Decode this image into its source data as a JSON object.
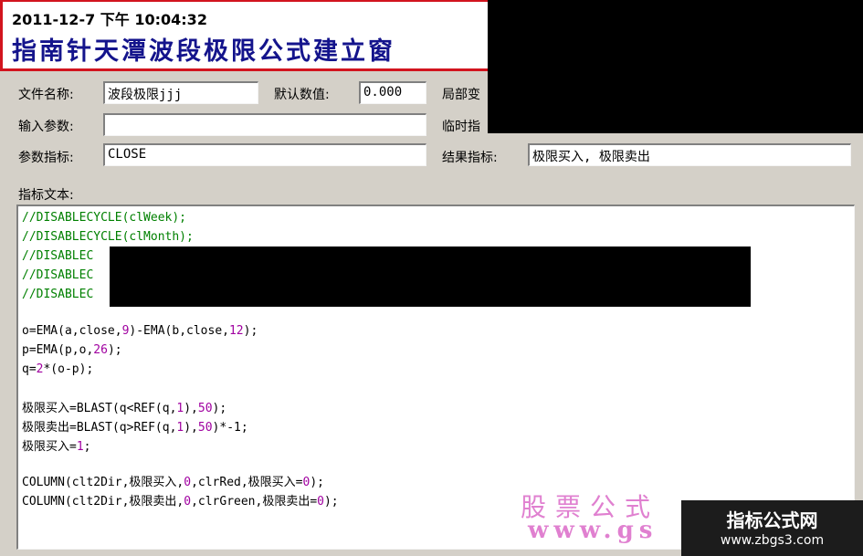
{
  "header": {
    "timestamp": "2011-12-7 下午 10:04:32",
    "title": "指南针天潭波段极限公式建立窗"
  },
  "form": {
    "file_name_label": "文件名称:",
    "file_name_value": "波段极限jjj",
    "default_value_label": "默认数值:",
    "default_value_value": "0.000",
    "local_label_partial": "局部变",
    "input_params_label": "输入参数:",
    "input_params_value": "",
    "temp_label_partial": "临时指",
    "param_indicator_label": "参数指标:",
    "param_indicator_value": "CLOSE",
    "result_indicator_label": "结果指标:",
    "result_indicator_value": "极限买入, 极限卖出",
    "text_section_label": "指标文本:"
  },
  "code": {
    "l1": "//DISABLECYCLE(clWeek);",
    "l2": "//DISABLECYCLE(clMonth);",
    "l3": "//DISABLEC",
    "l4": "//DISABLEC",
    "l5": "//DISABLEC",
    "l6a": "o=EMA(a,close,",
    "l6n1": "9",
    "l6b": ")-EMA(b,close,",
    "l6n2": "12",
    "l6c": ");",
    "l7a": "p=EMA(p,o,",
    "l7n1": "26",
    "l7b": ");",
    "l8a": "q=",
    "l8n1": "2",
    "l8b": "*(o-p);",
    "l9a": "极限买入=BLAST(q<REF(q,",
    "l9n1": "1",
    "l9b": "),",
    "l9n2": "50",
    "l9c": ");",
    "l10a": "极限卖出=BLAST(q>REF(q,",
    "l10n1": "1",
    "l10b": "),",
    "l10n2": "50",
    "l10c": ")*-1;",
    "l11a": "极限买入=",
    "l11n1": "1",
    "l11b": ";",
    "l12a": "COLUMN(clt2Dir,极限买入,",
    "l12n1": "0",
    "l12b": ",clrRed,极限买入=",
    "l12n2": "0",
    "l12c": ");",
    "l13a": "COLUMN(clt2Dir,极限卖出,",
    "l13n1": "0",
    "l13b": ",clrGreen,极限卖出=",
    "l13n2": "0",
    "l13c": ");"
  },
  "watermark": {
    "text": "股票公式",
    "url_partial": "www.gs"
  },
  "badge": {
    "title": "指标公式网",
    "url": "www.zbgs3.com"
  },
  "colors": {
    "title_border": "#d2141e",
    "title_text": "#14148c",
    "comment": "#008000",
    "number": "#a000a0",
    "watermark": "#e080d0"
  }
}
